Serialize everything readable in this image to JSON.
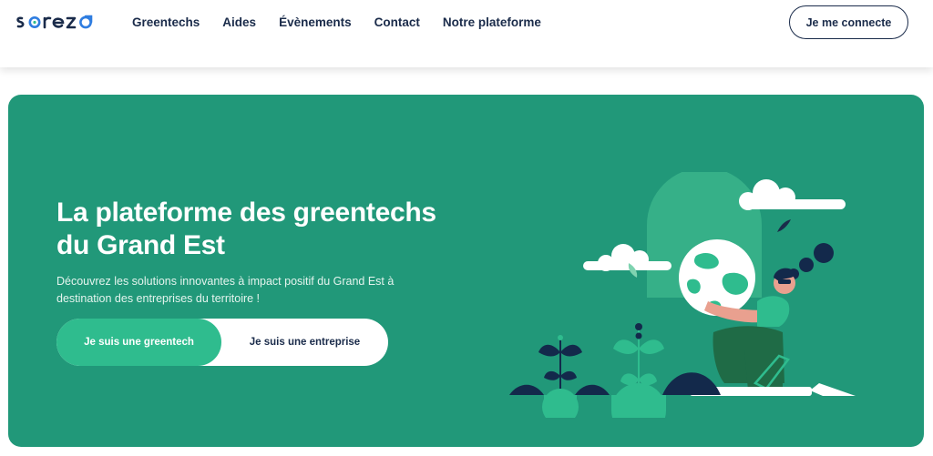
{
  "header": {
    "logo_text": "sorezo",
    "nav": [
      {
        "label": "Greentechs"
      },
      {
        "label": "Aides"
      },
      {
        "label": "Évènements"
      },
      {
        "label": "Contact"
      },
      {
        "label": "Notre plateforme"
      }
    ],
    "login_label": "Je me connecte"
  },
  "hero": {
    "title_line1": "La plateforme des greentechs",
    "title_line2": "du Grand Est",
    "subtitle_line1": "Découvrez les solutions innovantes à impact positif du Grand Est à",
    "subtitle_line2": "destination des entreprises du territoire !",
    "cta_primary": "Je suis une greentech",
    "cta_secondary": "Je suis une entreprise"
  },
  "colors": {
    "hero_bg": "#219879",
    "accent_green": "#2fbc8e",
    "navy": "#1a2b4a",
    "logo_blue": "#2f7de0"
  }
}
